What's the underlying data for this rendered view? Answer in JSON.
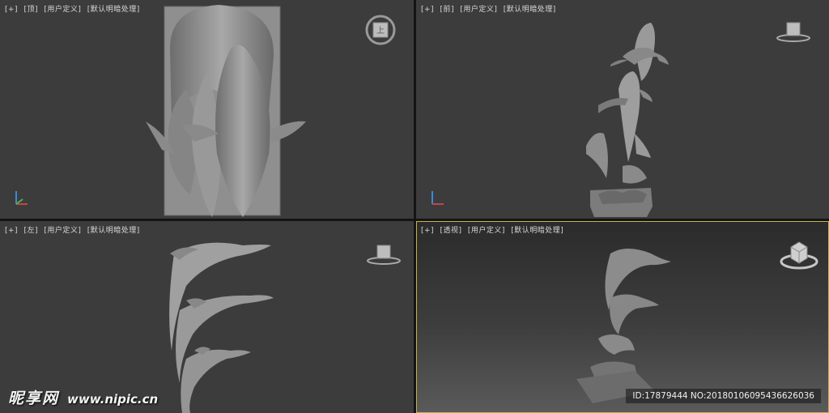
{
  "viewports": {
    "top": {
      "plus": "[+]",
      "view": "[顶]",
      "camera": "[用户定义]",
      "shading": "[默认明暗处理]",
      "cube_label": "上"
    },
    "front": {
      "plus": "[+]",
      "view": "[前]",
      "camera": "[用户定义]",
      "shading": "[默认明暗处理]"
    },
    "left": {
      "plus": "[+]",
      "view": "[左]",
      "camera": "[用户定义]",
      "shading": "[默认明暗处理]"
    },
    "perspective": {
      "plus": "[+]",
      "view": "[透视]",
      "camera": "[用户定义]",
      "shading": "[默认明暗处理]"
    }
  },
  "watermark": {
    "brand": "昵享网",
    "url": "www.nipic.cn",
    "id_text": "ID:17879444 NO:20180106095436626036"
  },
  "colors": {
    "viewport_bg": "#3c3c3c",
    "active_border": "#c9b14a",
    "model": "#8e8e8e"
  }
}
